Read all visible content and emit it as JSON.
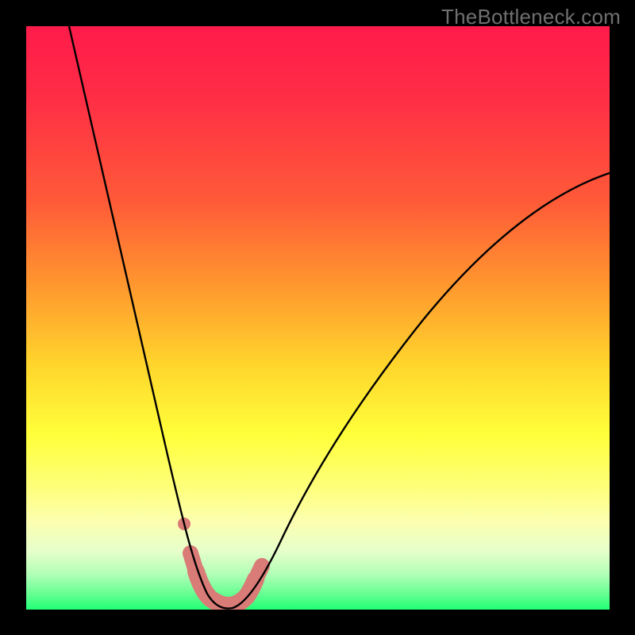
{
  "watermark": "TheBottleneck.com",
  "colors": {
    "top": "#ff1b4a",
    "red": "#ff2d46",
    "orange": "#ff8a2a",
    "yellow": "#ffee2e",
    "lightyellow": "#feff8e",
    "paleyellow": "#fbffc0",
    "mint": "#b3ffb7",
    "green": "#32ff77",
    "curve": "#000000",
    "marker": "#d97b77",
    "frame": "#000000"
  },
  "chart_data": {
    "type": "line",
    "title": "",
    "xlabel": "",
    "ylabel": "",
    "xlim": [
      0,
      100
    ],
    "ylim": [
      0,
      100
    ],
    "series": [
      {
        "name": "bottleneck-curve",
        "x": [
          7,
          10,
          13,
          16,
          19,
          22,
          24,
          26,
          27.5,
          29,
          30,
          31,
          32,
          33,
          34,
          36,
          38,
          41,
          45,
          50,
          56,
          63,
          71,
          80,
          90,
          100
        ],
        "y": [
          100,
          89,
          79,
          69,
          59,
          48,
          38,
          27,
          17,
          9,
          4,
          1.5,
          0.7,
          0.7,
          1.5,
          4,
          8,
          14,
          21,
          29,
          37,
          45,
          53,
          61,
          68,
          74
        ]
      }
    ],
    "markers": [
      {
        "name": "left-dot",
        "x": 27.8,
        "y": 15.8,
        "r": 1.0
      },
      {
        "name": "valley-band-start",
        "x": 29.3,
        "y": 6.5
      },
      {
        "name": "valley-band-end",
        "x": 36.8,
        "y": 6.2
      }
    ],
    "gradient_stops": [
      {
        "pct": 0,
        "color": "#ff1b4a"
      },
      {
        "pct": 30,
        "color": "#ff5a38"
      },
      {
        "pct": 55,
        "color": "#ffca2a"
      },
      {
        "pct": 73,
        "color": "#ffff40"
      },
      {
        "pct": 82,
        "color": "#feff8e"
      },
      {
        "pct": 88,
        "color": "#edffc9"
      },
      {
        "pct": 93,
        "color": "#a7ffb1"
      },
      {
        "pct": 100,
        "color": "#22ff77"
      }
    ]
  }
}
